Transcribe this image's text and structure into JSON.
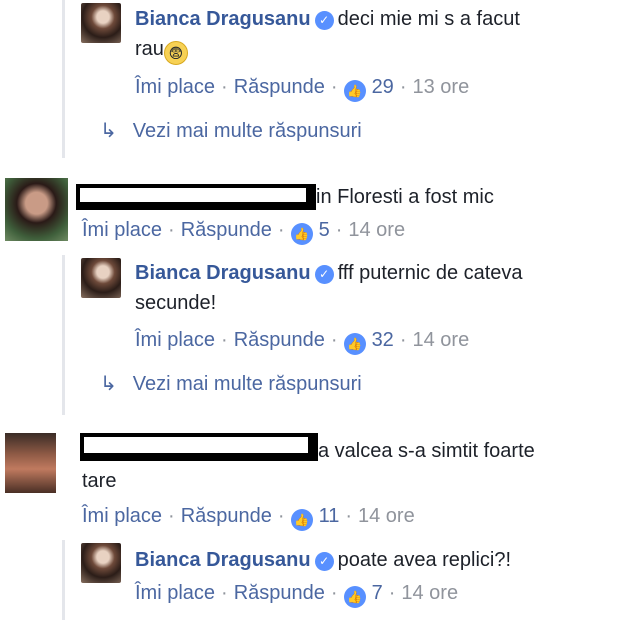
{
  "actions": {
    "like": "Îmi place",
    "reply": "Răspunde",
    "separator": "·",
    "view_more": "Vezi mai multe răspunsuri"
  },
  "reply1": {
    "author": "Bianca Dragusanu",
    "text_line1": "deci mie mi s a facut",
    "text_line2": "rau",
    "likes": "29",
    "time": "13 ore"
  },
  "comment1": {
    "text": "in Floresti a fost mic",
    "likes": "5",
    "time": "14 ore"
  },
  "reply2": {
    "author": "Bianca Dragusanu",
    "text_line1": "fff puternic de cateva",
    "text_line2": "secunde!",
    "likes": "32",
    "time": "14 ore"
  },
  "comment2": {
    "text_line1": "a valcea s-a simtit foarte",
    "text_line2": "tare",
    "likes": "11",
    "time": "14 ore"
  },
  "reply3": {
    "author": "Bianca Dragusanu",
    "text": "poate avea replici?!",
    "likes": "7",
    "time": "14 ore"
  },
  "icons": {
    "verified": "check-badge-icon",
    "like": "thumbs-up-icon",
    "reply_arrow": "reply-arrow-icon",
    "emoji": "fearful-face-emoji"
  },
  "colors": {
    "link": "#4b67a1",
    "name": "#365899",
    "muted": "#90949c",
    "like_badge": "#5890ff"
  }
}
